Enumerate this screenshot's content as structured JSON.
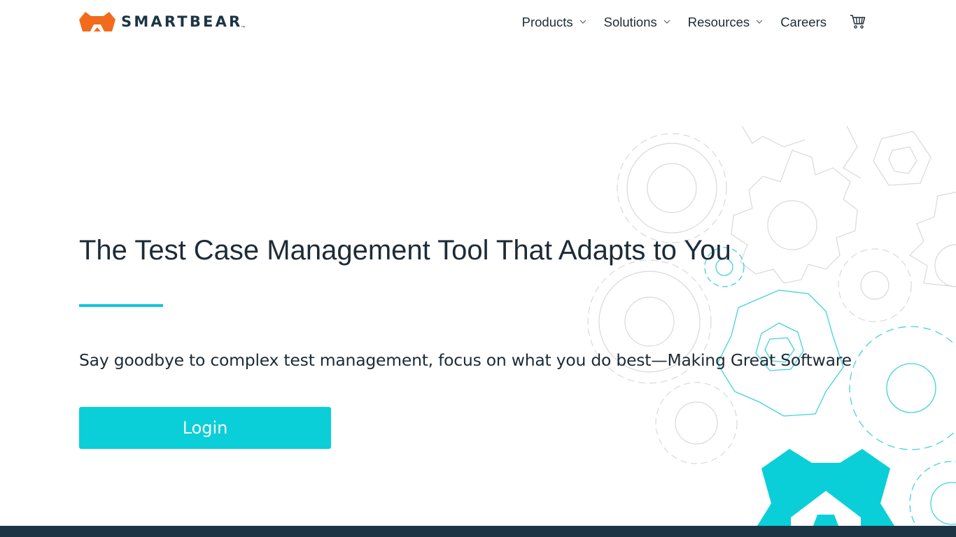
{
  "header": {
    "logo_text": "SMARTBEAR",
    "logo_tm": "™",
    "logo_icon": "bear-head-icon",
    "nav": [
      {
        "label": "Products",
        "has_dropdown": true
      },
      {
        "label": "Solutions",
        "has_dropdown": true
      },
      {
        "label": "Resources",
        "has_dropdown": true
      },
      {
        "label": "Careers",
        "has_dropdown": false
      }
    ],
    "cart_icon": "shopping-cart-icon"
  },
  "hero": {
    "title": "The Test Case Management Tool That Adapts to You",
    "subtitle": "Say goodbye to complex test management, focus on what you do best—Making Great Software",
    "login_label": "Login"
  },
  "colors": {
    "brand_orange": "#f26b1d",
    "accent_teal": "#0acfd8",
    "navy": "#1d3445",
    "text": "#1d2b36"
  }
}
